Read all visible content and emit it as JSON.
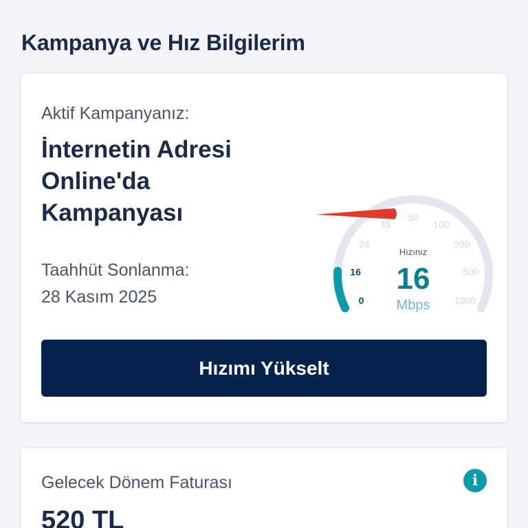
{
  "section_title": "Kampanya ve Hız Bilgilerim",
  "campaign": {
    "label": "Aktif Kampanyanız:",
    "name": "İnternetin Adresi Online'da Kampanyası",
    "commitment_label": "Taahhüt Sonlanma:",
    "commitment_date": "28 Kasım 2025"
  },
  "speed_gauge": {
    "ticks": [
      "0",
      "16",
      "24",
      "35",
      "50",
      "100",
      "200",
      "500",
      "1000"
    ],
    "speed_caption": "Hızınız",
    "speed_value": "16",
    "speed_unit": "Mbps",
    "current_tick_index": 1
  },
  "upgrade_button_label": "Hızımı Yükselt",
  "invoice": {
    "label": "Gelecek Dönem Faturası",
    "amount": "520 TL"
  },
  "colors": {
    "primary_navy": "#06234d",
    "accent_teal": "#0a9bac",
    "needle_red": "#e03a2a",
    "gauge_track": "#e3e6ee"
  },
  "icons": {
    "info": "info-icon"
  }
}
